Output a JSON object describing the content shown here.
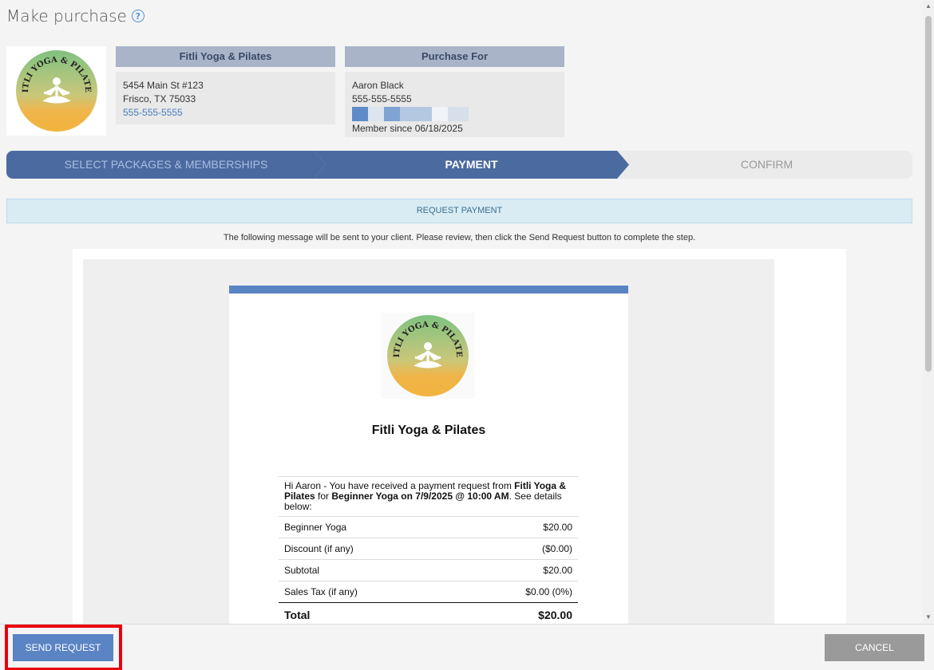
{
  "page": {
    "title": "Make purchase"
  },
  "studio": {
    "header": "Fitli Yoga & Pilates",
    "address1": "5454 Main St #123",
    "address2": "Frisco, TX 75033",
    "phone": "555-555-5555",
    "logo_text": "FITLI YOGA & PILATES"
  },
  "client": {
    "header": "Purchase For",
    "name": "Aaron Black",
    "phone": "555-555-5555",
    "member_since": "Member since 06/18/2025"
  },
  "steps": [
    {
      "label": "SELECT PACKAGES & MEMBERSHIPS",
      "state": "done"
    },
    {
      "label": "PAYMENT",
      "state": "active"
    },
    {
      "label": "CONFIRM",
      "state": "pending"
    }
  ],
  "request_bar": {
    "label": "REQUEST PAYMENT"
  },
  "message": "The following message will be sent to your client.  Please review, then click the Send Request  button to complete the step.",
  "email": {
    "studio_name": "Fitli Yoga & Pilates",
    "intro_prefix": "Hi Aaron - You have received a payment request from ",
    "intro_studio": "Fitli Yoga & Pilates",
    "intro_mid": " for ",
    "intro_item": "Beginner Yoga on 7/9/2025 @ 10:00 AM",
    "intro_suffix": ". See details below:",
    "rows": [
      {
        "label": "Beginner Yoga",
        "value": "$20.00"
      },
      {
        "label": "Discount (if any)",
        "value": "($0.00)"
      },
      {
        "label": "Subtotal",
        "value": "$20.00"
      },
      {
        "label": "Sales Tax (if any)",
        "value": "$0.00 (0%)"
      }
    ],
    "total_label": "Total",
    "total_value": "$20.00"
  },
  "footer": {
    "send_label": "SEND REQUEST",
    "cancel_label": "CANCEL"
  },
  "colors": {
    "primary": "#4a6aa0",
    "button_blue": "#5b84c4",
    "highlight": "#e8000b"
  }
}
